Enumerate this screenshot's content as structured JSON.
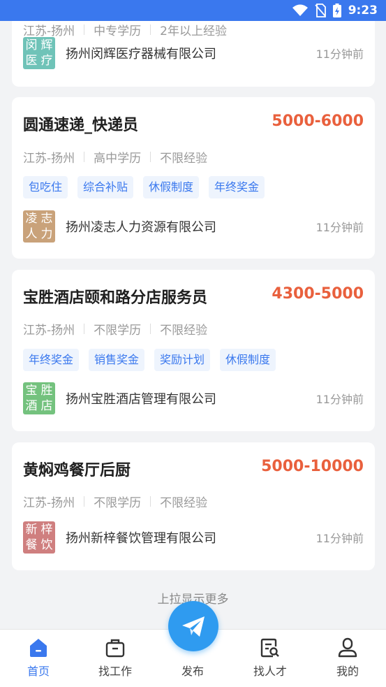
{
  "status_bar": {
    "time": "9:23"
  },
  "partial_card": {
    "meta": [
      "江苏-扬州",
      "中专学历",
      "2年以上经验"
    ],
    "company": {
      "logo_chars": [
        "闵",
        "辉",
        "医",
        "疗"
      ],
      "logo_color": "#6fc3b8",
      "name": "扬州闵辉医疗器械有限公司",
      "time": "11分钟前"
    }
  },
  "jobs": [
    {
      "title": "圆通速递_快递员",
      "salary": "5000-6000",
      "meta": [
        "江苏-扬州",
        "高中学历",
        "不限经验"
      ],
      "tags": [
        "包吃住",
        "综合补贴",
        "休假制度",
        "年终奖金"
      ],
      "company": {
        "logo_chars": [
          "凌",
          "志",
          "人",
          "力"
        ],
        "logo_color": "#c9a27a",
        "name": "扬州凌志人力资源有限公司",
        "time": "11分钟前"
      }
    },
    {
      "title": "宝胜酒店颐和路分店服务员",
      "salary": "4300-5000",
      "meta": [
        "江苏-扬州",
        "不限学历",
        "不限经验"
      ],
      "tags": [
        "年终奖金",
        "销售奖金",
        "奖励计划",
        "休假制度"
      ],
      "company": {
        "logo_chars": [
          "宝",
          "胜",
          "酒",
          "店"
        ],
        "logo_color": "#74c27e",
        "name": "扬州宝胜酒店管理有限公司",
        "time": "11分钟前"
      }
    },
    {
      "title": "黄焖鸡餐厅后厨",
      "salary": "5000-10000",
      "meta": [
        "江苏-扬州",
        "不限学历",
        "不限经验"
      ],
      "tags": [],
      "company": {
        "logo_chars": [
          "新",
          "梓",
          "餐",
          "饮"
        ],
        "logo_color": "#cf7f7f",
        "name": "扬州新梓餐饮管理有限公司",
        "time": "11分钟前"
      }
    }
  ],
  "load_more": "上拉显示更多",
  "tabbar": {
    "items": [
      {
        "label": "首页",
        "icon": "home-icon",
        "active": true
      },
      {
        "label": "找工作",
        "icon": "briefcase-icon",
        "active": false
      },
      {
        "label": "发布",
        "icon": "paper-plane-icon",
        "active": false
      },
      {
        "label": "找人才",
        "icon": "resume-search-icon",
        "active": false
      },
      {
        "label": "我的",
        "icon": "user-icon",
        "active": false
      }
    ]
  },
  "colors": {
    "accent": "#3a78ee",
    "salary": "#e9603d",
    "fab": "#2f9bf0"
  }
}
